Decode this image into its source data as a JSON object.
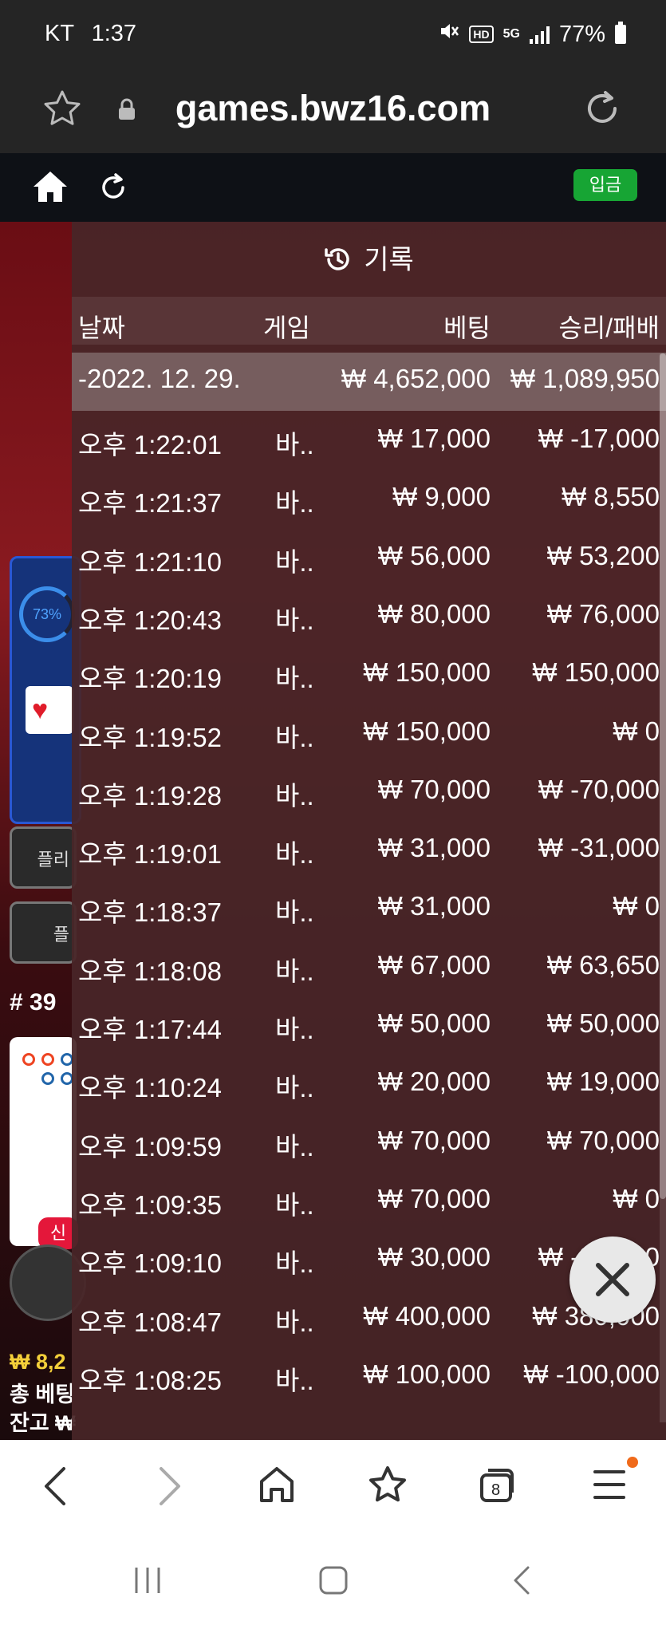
{
  "status_bar": {
    "carrier": "KT",
    "time": "1:37",
    "battery": "77%",
    "icons": [
      "mute-icon",
      "hd-icon",
      "5g-icon",
      "signal-icon",
      "battery-icon"
    ]
  },
  "browser": {
    "url": "games.bwz16.com",
    "tab_count": "8"
  },
  "site": {
    "deposit_label": "입금"
  },
  "background_game": {
    "progress_percent": "73%",
    "partial_button_1": "플",
    "partial_button_2": "플리",
    "partial_button_3": "플",
    "round": "# 39",
    "new_badge": "신",
    "line1": "₩ 8,2",
    "line2": "총 베팅",
    "line3": "잔고 ₩"
  },
  "history": {
    "title": "기록",
    "columns": {
      "date": "날짜",
      "game": "게임",
      "bet": "베팅",
      "result": "승리/패배"
    },
    "summary": {
      "date": "-2022. 12. 29.",
      "bet": "₩ 4,652,000",
      "result": "₩ 1,089,950"
    },
    "rows": [
      {
        "time": "오후 1:22:01",
        "game": "바..",
        "bet": "₩ 17,000",
        "result": "₩ -17,000"
      },
      {
        "time": "오후 1:21:37",
        "game": "바..",
        "bet": "₩ 9,000",
        "result": "₩ 8,550"
      },
      {
        "time": "오후 1:21:10",
        "game": "바..",
        "bet": "₩ 56,000",
        "result": "₩ 53,200"
      },
      {
        "time": "오후 1:20:43",
        "game": "바..",
        "bet": "₩ 80,000",
        "result": "₩ 76,000"
      },
      {
        "time": "오후 1:20:19",
        "game": "바..",
        "bet": "₩ 150,000",
        "result": "₩ 150,000"
      },
      {
        "time": "오후 1:19:52",
        "game": "바..",
        "bet": "₩ 150,000",
        "result": "₩ 0"
      },
      {
        "time": "오후 1:19:28",
        "game": "바..",
        "bet": "₩ 70,000",
        "result": "₩ -70,000"
      },
      {
        "time": "오후 1:19:01",
        "game": "바..",
        "bet": "₩ 31,000",
        "result": "₩ -31,000"
      },
      {
        "time": "오후 1:18:37",
        "game": "바..",
        "bet": "₩ 31,000",
        "result": "₩ 0"
      },
      {
        "time": "오후 1:18:08",
        "game": "바..",
        "bet": "₩ 67,000",
        "result": "₩ 63,650"
      },
      {
        "time": "오후 1:17:44",
        "game": "바..",
        "bet": "₩ 50,000",
        "result": "₩ 50,000"
      },
      {
        "time": "오후 1:10:24",
        "game": "바..",
        "bet": "₩ 20,000",
        "result": "₩ 19,000"
      },
      {
        "time": "오후 1:09:59",
        "game": "바..",
        "bet": "₩ 70,000",
        "result": "₩ 70,000"
      },
      {
        "time": "오후 1:09:35",
        "game": "바..",
        "bet": "₩ 70,000",
        "result": "₩ 0"
      },
      {
        "time": "오후 1:09:10",
        "game": "바..",
        "bet": "₩ 30,000",
        "result": "₩ -30,000"
      },
      {
        "time": "오후 1:08:47",
        "game": "바..",
        "bet": "₩ 400,000",
        "result": "₩ 380,000"
      },
      {
        "time": "오후 1:08:25",
        "game": "바..",
        "bet": "₩ 100,000",
        "result": "₩ -100,000"
      }
    ]
  }
}
